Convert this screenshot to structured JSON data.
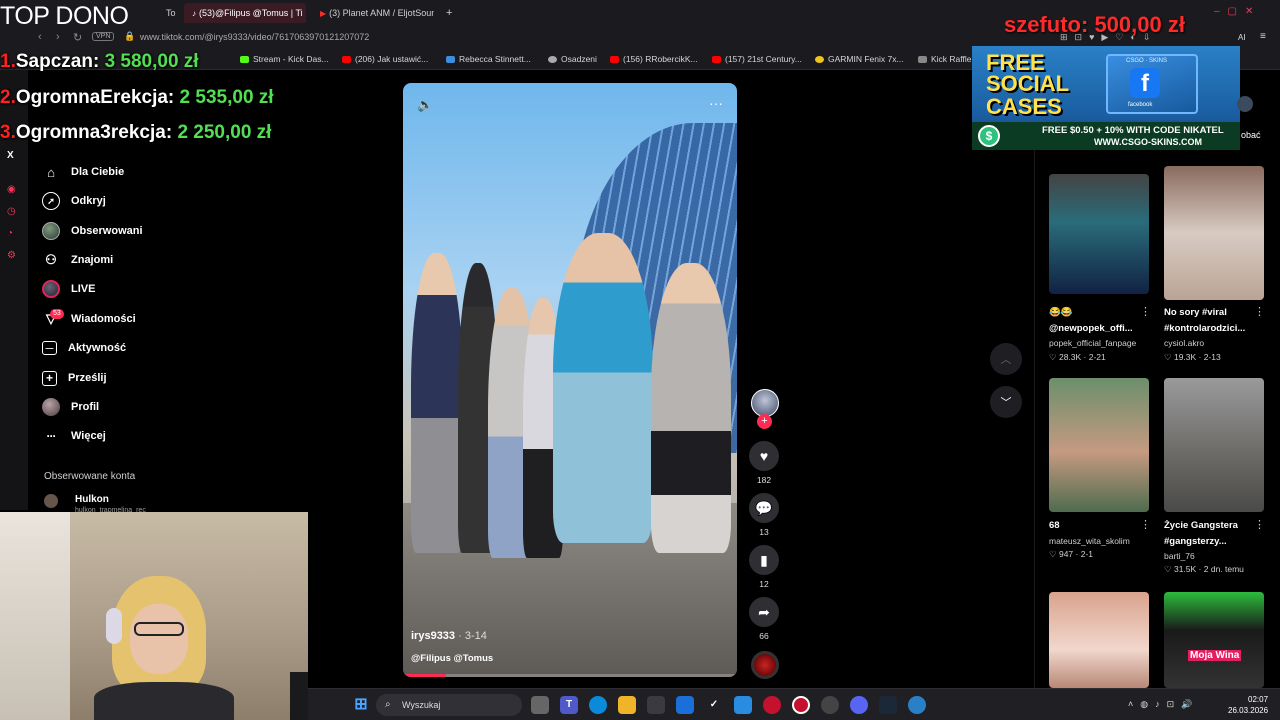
{
  "overlay": {
    "top_dono_title": "TOP DONO",
    "donors": [
      {
        "rank": "1.",
        "name": "Sapczan:",
        "amount": "3 580,00 zł"
      },
      {
        "rank": "2.",
        "name": "OgromnaErekcja:",
        "amount": "2 535,00 zł"
      },
      {
        "rank": "3.",
        "name": "Ogromna3rekcja:",
        "amount": "2 250,00 zł"
      }
    ],
    "latest_donation": "szefuto: 500,00 zł"
  },
  "browser": {
    "tabs": [
      {
        "label": "To"
      },
      {
        "label": "(53)@Filipus @Tomus | Ti"
      },
      {
        "label": "(3) Planet ANM / EljotSoun"
      }
    ],
    "url": "www.tiktok.com/@irys9333/video/7617063970121207072",
    "vpn_label": "VPN",
    "ai_label": "AI",
    "bookmarks": [
      {
        "label": "Stream - Kick Das..."
      },
      {
        "label": "(206) Jak ustawić..."
      },
      {
        "label": "Rebecca Stinnett..."
      },
      {
        "label": "Osadzeni"
      },
      {
        "label": "(156) RRobercikK..."
      },
      {
        "label": "(157) 21st Century..."
      },
      {
        "label": "GARMIN Fenix 7x..."
      },
      {
        "label": "Kick Raffle"
      }
    ]
  },
  "sidebar": {
    "items": [
      {
        "label": "Dla Ciebie",
        "icon": "home-icon"
      },
      {
        "label": "Odkryj",
        "icon": "compass-icon"
      },
      {
        "label": "Obserwowani",
        "icon": "following-avatar-icon"
      },
      {
        "label": "Znajomi",
        "icon": "friends-icon"
      },
      {
        "label": "LIVE",
        "icon": "live-icon"
      },
      {
        "label": "Wiadomości",
        "icon": "messages-icon"
      },
      {
        "label": "Aktywność",
        "icon": "activity-icon"
      },
      {
        "label": "Prześlij",
        "icon": "upload-icon"
      },
      {
        "label": "Profil",
        "icon": "profile-icon"
      },
      {
        "label": "Więcej",
        "icon": "more-icon"
      }
    ],
    "messages_badge": "53",
    "followed_header": "Obserwowane konta",
    "followed_accounts": [
      {
        "name": "Hulkon",
        "handle": "hulkon_trapmelina_rec"
      }
    ]
  },
  "video": {
    "author": "irys9333",
    "date": "· 3-14",
    "caption": "@Filipus @Tomus",
    "progress": 0.13,
    "likes": "182",
    "comments": "13",
    "saves": "12",
    "shares": "66"
  },
  "ad": {
    "line1": "FREE",
    "line2": "SOCIAL",
    "line3": "CASES",
    "promo": "FREE $0.50 + 10% WITH CODE NIKATEL",
    "site": "WWW.CSGO-SKINS.COM",
    "box_label": "CSGO · SKINS",
    "fb_letter": "f",
    "box_sub": "facebook"
  },
  "download_label": "obać",
  "recommended": [
    {
      "title": "😂😂",
      "subtitle": "@newpopek_offi...",
      "user": "popek_official_fanpage",
      "stats": "♡ 28.3K · 2-21"
    },
    {
      "title": "No sory #viral",
      "subtitle": "#kontrolarodzici...",
      "user": "cysiol.akro",
      "stats": "♡ 19.3K · 2-13"
    },
    {
      "title": "68",
      "subtitle": "",
      "user": "mateusz_wita_skolim",
      "stats": "♡ 947 · 2-1"
    },
    {
      "title": "Życie Gangstera",
      "subtitle": "#gangsterzy...",
      "user": "barti_76",
      "stats": "♡ 31.5K · 2 dn. temu"
    },
    {
      "title": "",
      "subtitle": "",
      "user": "",
      "stats": "",
      "overlay_text": "Moja Wina"
    }
  ],
  "taskbar": {
    "search_placeholder": "Wyszukaj",
    "time": "02:07",
    "date": "26.03.2026"
  },
  "colors": {
    "tiktok_red": "#fe2c55",
    "donor_amount": "#52e052",
    "donor_rank": "#ff2020"
  }
}
